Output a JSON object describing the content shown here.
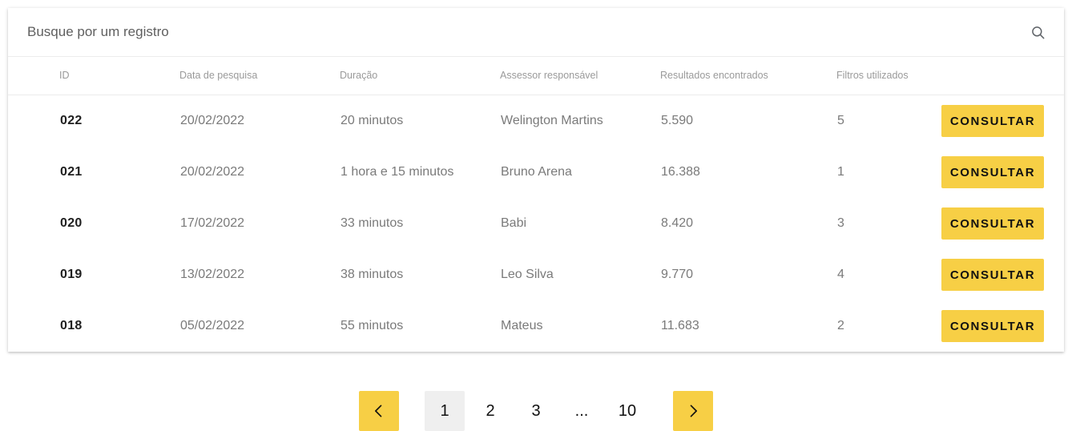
{
  "search": {
    "placeholder": "Busque por um registro",
    "icon": "search-icon"
  },
  "table": {
    "headers": {
      "id": "ID",
      "date": "Data de pesquisa",
      "duration": "Duração",
      "advisor": "Assessor responsável",
      "results": "Resultados encontrados",
      "filters": "Filtros utilizados"
    },
    "rows": [
      {
        "id": "022",
        "date": "20/02/2022",
        "duration": "20 minutos",
        "advisor": "Welington Martins",
        "results": "5.590",
        "filters": "5",
        "action": "CONSULTAR"
      },
      {
        "id": "021",
        "date": "20/02/2022",
        "duration": "1 hora e 15 minutos",
        "advisor": "Bruno Arena",
        "results": "16.388",
        "filters": "1",
        "action": "CONSULTAR"
      },
      {
        "id": "020",
        "date": "17/02/2022",
        "duration": "33 minutos",
        "advisor": "Babi",
        "results": "8.420",
        "filters": "3",
        "action": "CONSULTAR"
      },
      {
        "id": "019",
        "date": "13/02/2022",
        "duration": "38 minutos",
        "advisor": "Leo Silva",
        "results": "9.770",
        "filters": "4",
        "action": "CONSULTAR"
      },
      {
        "id": "018",
        "date": "05/02/2022",
        "duration": "55 minutos",
        "advisor": "Mateus",
        "results": "11.683",
        "filters": "2",
        "action": "CONSULTAR"
      }
    ]
  },
  "pagination": {
    "prev_icon": "chevron-left-icon",
    "next_icon": "chevron-right-icon",
    "pages": [
      "1",
      "2",
      "3"
    ],
    "ellipsis": "...",
    "last": "10",
    "current": "1"
  },
  "colors": {
    "accent": "#f7cf45",
    "active_page_bg": "#efefef"
  }
}
